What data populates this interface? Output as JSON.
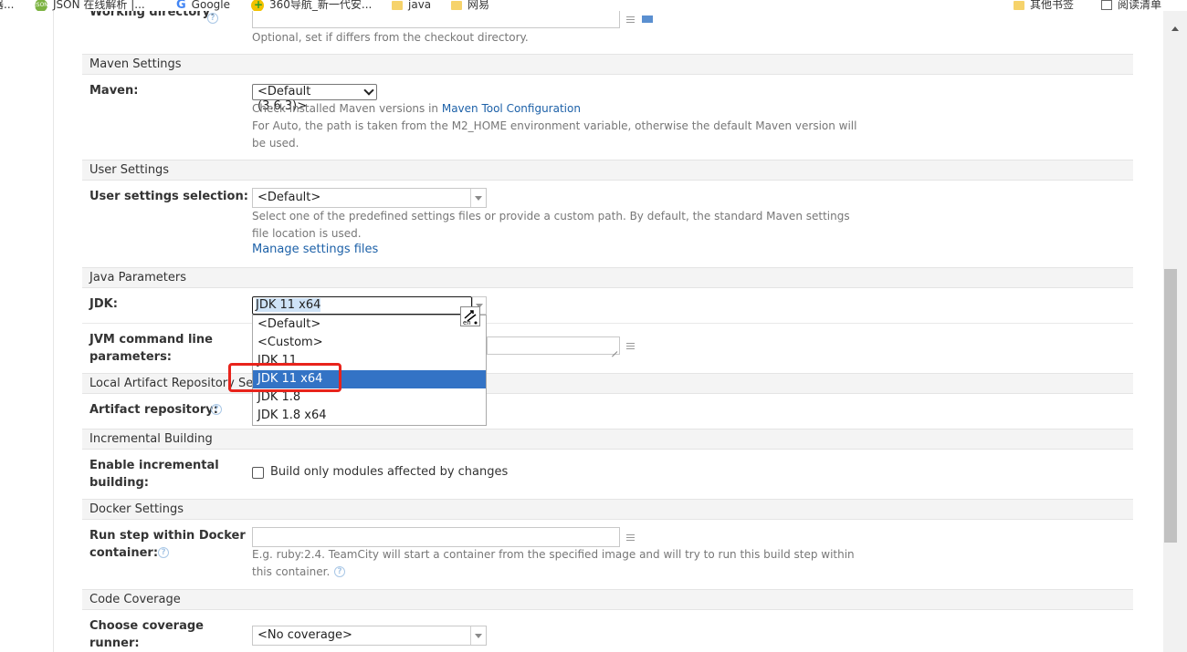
{
  "bookmarks": {
    "items": [
      {
        "label": "JSON 在线解析 |...",
        "icon": "json-icon"
      },
      {
        "label": "Google",
        "icon": "google-icon"
      },
      {
        "label": "360导航_新一代安...",
        "icon": "360-icon"
      },
      {
        "label": "java",
        "icon": "folder-icon"
      },
      {
        "label": "网易",
        "icon": "folder-icon"
      }
    ],
    "cut_left": "器...",
    "other_bookmarks": "其他书签",
    "reading_list": "阅读清单"
  },
  "working_directory": {
    "label": "Working directory:",
    "hint": "Optional, set if differs from the checkout directory."
  },
  "maven_settings": {
    "header": "Maven Settings",
    "maven_label": "Maven:",
    "maven_value": "<Default (3.6.3)>",
    "hint_prefix": "Check installed Maven versions in ",
    "hint_link": "Maven Tool Configuration",
    "hint2": "For Auto, the path is taken from the M2_HOME environment variable, otherwise the default Maven version will",
    "hint3": "be used."
  },
  "user_settings": {
    "header": "User Settings",
    "label": "User settings selection:",
    "value": "<Default>",
    "hint1": "Select one of the predefined settings files or provide a custom path. By default, the standard Maven settings",
    "hint2": "file location is used.",
    "manage_link": "Manage settings files"
  },
  "java_parameters": {
    "header": "Java Parameters",
    "jdk_label": "JDK:",
    "jdk_value": "JDK 11 x64",
    "jvm_label_1": "JVM command line",
    "jvm_label_2": "parameters:",
    "jdk_options": [
      "<Default>",
      "<Custom>",
      "JDK 11",
      "JDK 11 x64",
      "JDK 1.8",
      "JDK 1.8 x64"
    ],
    "selected_index": 3
  },
  "local_artifact": {
    "header": "Local Artifact Repository Settings",
    "label": "Artifact repository:"
  },
  "incremental": {
    "header": "Incremental Building",
    "label_1": "Enable incremental",
    "label_2": "building:",
    "checkbox_label": "Build only modules affected by changes",
    "checked": false
  },
  "docker": {
    "header": "Docker Settings",
    "label_1": "Run step within Docker",
    "label_2": "container:",
    "hint1": "E.g. ruby:2.4. TeamCity will start a container from the specified image and will try to run this build step within",
    "hint2": "this container."
  },
  "coverage": {
    "header": "Code Coverage",
    "label_1": "Choose coverage",
    "label_2": "runner:",
    "value": "<No coverage>"
  },
  "colors": {
    "selected_option": "#3373c5",
    "link": "#1d61a8",
    "highlight_border": "#e8231b"
  }
}
